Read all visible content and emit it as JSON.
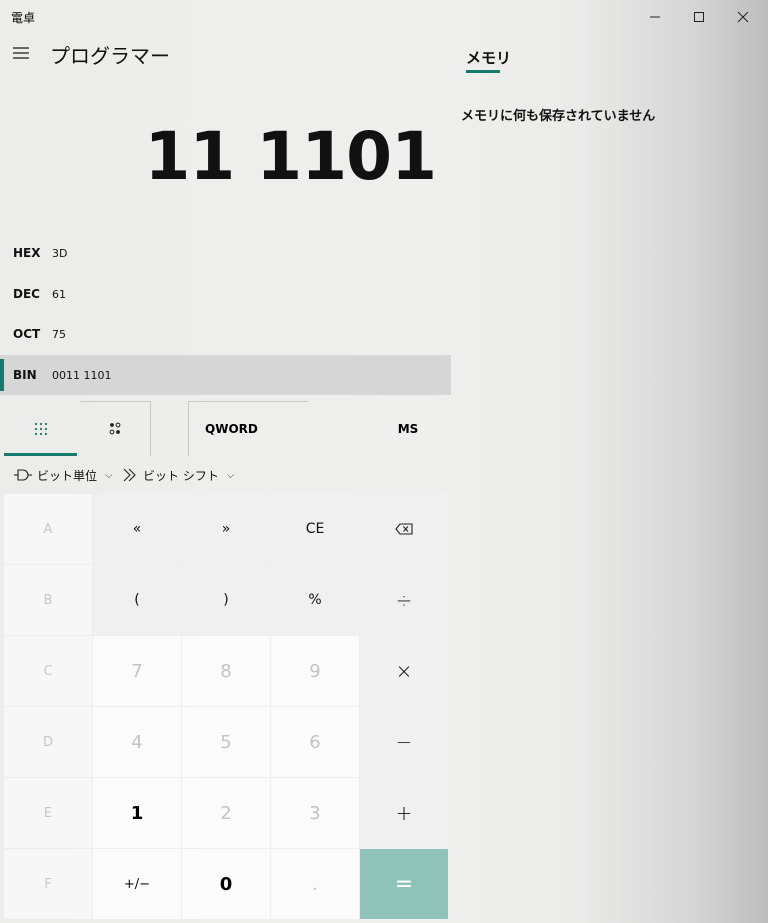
{
  "window": {
    "title": "電卓"
  },
  "header": {
    "mode_title": "プログラマー"
  },
  "memory": {
    "tab_label": "メモリ",
    "empty_text": "メモリに何も保存されていません"
  },
  "display": {
    "value": "11 1101"
  },
  "radix": [
    {
      "label": "HEX",
      "value": "3D"
    },
    {
      "label": "DEC",
      "value": "61"
    },
    {
      "label": "OCT",
      "value": "75"
    },
    {
      "label": "BIN",
      "value": "0011 1101"
    }
  ],
  "tabs": {
    "word_size": "QWORD",
    "memory_store": "MS"
  },
  "dropdowns": {
    "bitwise": "ビット単位",
    "bitshift": "ビット シフト"
  },
  "keys": {
    "A": "A",
    "lshift": "«",
    "rshift": "»",
    "CE": "CE",
    "B": "B",
    "lparen": "(",
    "rparen": ")",
    "mod": "%",
    "div": "÷",
    "C": "C",
    "k7": "7",
    "k8": "8",
    "k9": "9",
    "mul": "×",
    "D": "D",
    "k4": "4",
    "k5": "5",
    "k6": "6",
    "sub": "−",
    "E": "E",
    "k1": "1",
    "k2": "2",
    "k3": "3",
    "add": "+",
    "F": "F",
    "negate": "+/−",
    "k0": "0",
    "dot": ".",
    "eq": "="
  },
  "colors": {
    "accent": "#167a6d",
    "equals_bg": "#8fc3b9"
  }
}
